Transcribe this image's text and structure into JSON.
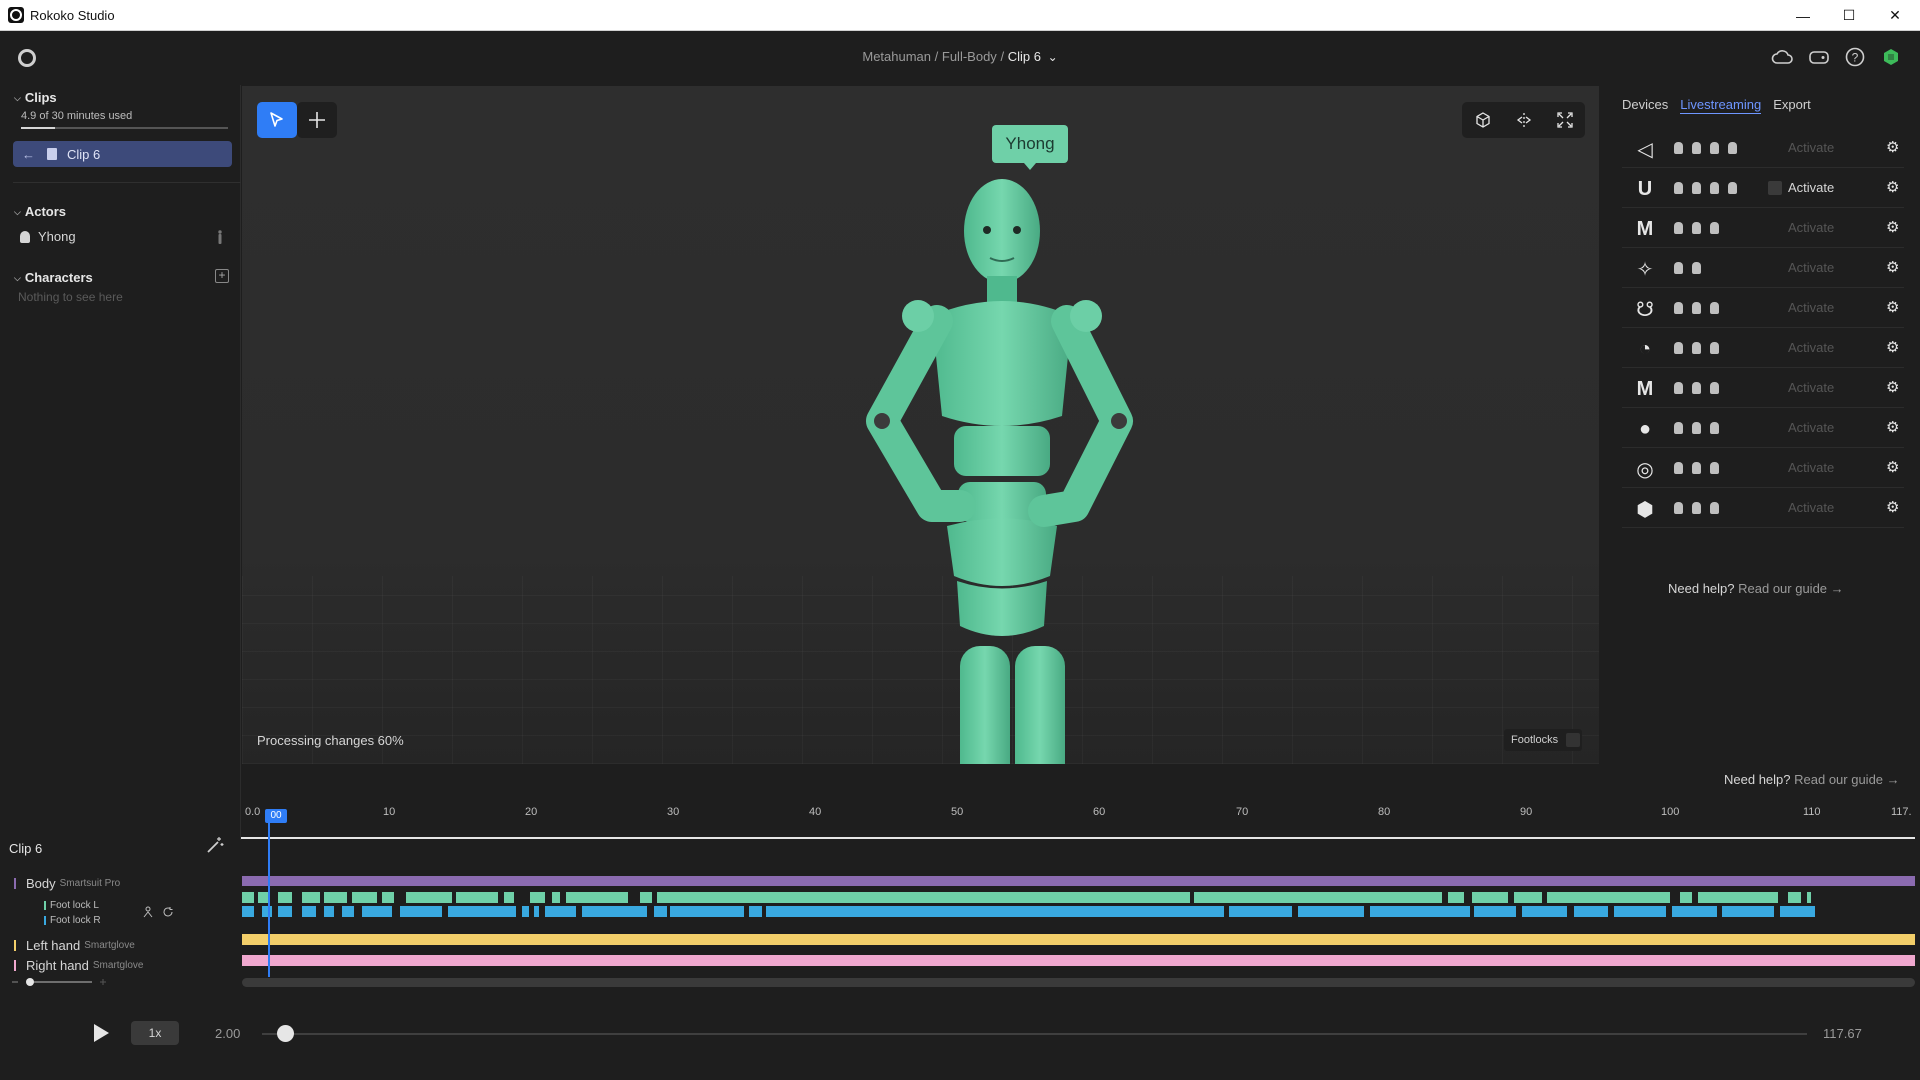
{
  "window": {
    "title": "Rokoko Studio"
  },
  "header": {
    "breadcrumb": [
      "Metahuman",
      "Full-Body"
    ],
    "separator": "/",
    "current_clip": "Clip 6",
    "chevron": "⌄"
  },
  "sidebar": {
    "clips_title": "Clips",
    "usage_text": "4.9 of 30 minutes used",
    "usage_fraction": 0.163,
    "clip_item": "Clip 6",
    "actors_title": "Actors",
    "actor_name": "Yhong",
    "characters_title": "Characters",
    "characters_empty": "Nothing to see here",
    "add_symbol": "+"
  },
  "viewport": {
    "actor_tag": "Yhong",
    "processing": "Processing changes 60%",
    "footlocks_label": "Footlocks",
    "accent_color": "#6fd0a8"
  },
  "right_panel": {
    "tabs": [
      "Devices",
      "Livestreaming",
      "Export"
    ],
    "active_tab": "Livestreaming",
    "activate_label": "Activate",
    "integrations": [
      {
        "logo": "unity-icon",
        "glyph": "◁",
        "chips": 4,
        "enabled": false
      },
      {
        "logo": "unreal-icon",
        "glyph": "U",
        "chips": 4,
        "enabled": true
      },
      {
        "logo": "motionbuilder-icon",
        "glyph": "M",
        "chips": 3,
        "enabled": false
      },
      {
        "logo": "isadora-icon",
        "glyph": "✧",
        "chips": 2,
        "enabled": false
      },
      {
        "logo": "houdini-icon",
        "glyph": "☋",
        "chips": 3,
        "enabled": false
      },
      {
        "logo": "blender-icon",
        "glyph": "◔",
        "chips": 3,
        "enabled": false
      },
      {
        "logo": "maya-icon",
        "glyph": "M",
        "chips": 3,
        "enabled": false
      },
      {
        "logo": "custom-icon",
        "glyph": "●",
        "chips": 3,
        "enabled": false
      },
      {
        "logo": "siemens-icon",
        "glyph": "◎",
        "chips": 3,
        "enabled": false
      },
      {
        "logo": "omniverse-icon",
        "glyph": "⬢",
        "chips": 3,
        "enabled": false
      }
    ],
    "help_text": "Need help?",
    "help_link": "Read our guide →"
  },
  "timeline": {
    "clip_name": "Clip 6",
    "help_text": "Need help?",
    "help_link": "Read our guide →",
    "ruler_ticks": [
      "0.0",
      "10",
      "20",
      "30",
      "40",
      "50",
      "60",
      "70",
      "80",
      "90",
      "100",
      "110",
      "117."
    ],
    "playhead_label": "00",
    "tracks": [
      {
        "name": "Body",
        "device": "Smartsuit Pro",
        "color": "#8b6bb0"
      },
      {
        "name": "Left hand",
        "device": "Smartglove",
        "color": "#f3cf6a"
      },
      {
        "name": "Right hand",
        "device": "Smartglove",
        "color": "#f0a8cf"
      }
    ],
    "foot_locks": [
      {
        "name": "Foot lock L",
        "color": "#6fd0a8"
      },
      {
        "name": "Foot lock R",
        "color": "#39a9e0"
      }
    ]
  },
  "transport": {
    "speed": "1x",
    "start_time": "2.00",
    "end_time": "117.67",
    "position_fraction": 0.01
  }
}
